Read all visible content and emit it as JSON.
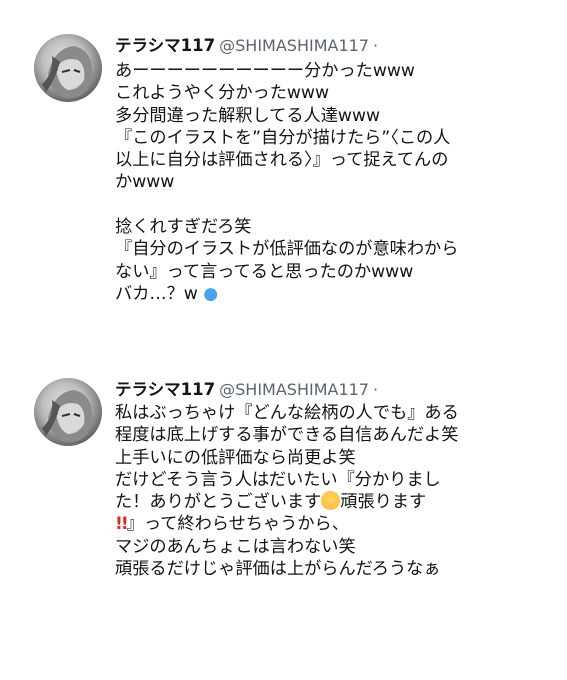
{
  "tweets": [
    {
      "name": "テラシマ117",
      "handle": "@SHIMASHIMA117",
      "dot": "·",
      "lines": [
        "あーーーーーーーーーー分かったwww",
        "これようやく分かったwww",
        "多分間違った解釈してる人達www",
        "『このイラストを”自分が描けたら”〈この人",
        "以上に自分は評価される〉』って捉えてんの",
        "かwww",
        "",
        "捻くれすぎだろ笑",
        "『自分のイラストが低評価なのが意味わから",
        "ない』って言ってると思ったのかwww",
        "バカ…？w"
      ],
      "emoji_last": "💧"
    },
    {
      "name": "テラシマ117",
      "handle": "@SHIMASHIMA117",
      "dot": "·",
      "lines": [
        "私はぶっちゃけ『どんな絵柄の人でも』ある",
        "程度は底上げする事ができる自信あんだよ笑",
        "上手いにの低評価なら尚更よ笑",
        "だけどそう言う人はだいたい『分かりまし",
        "た！ありがとうございます",
        "頑張ります",
        "』って終わらせちゃうから、",
        "マジのあんちょこは言わない笑",
        "頑張るだけじゃ評価は上がらんだろうなぁ"
      ],
      "emoji_hug": "🤗",
      "emoji_bang": "‼️"
    }
  ]
}
